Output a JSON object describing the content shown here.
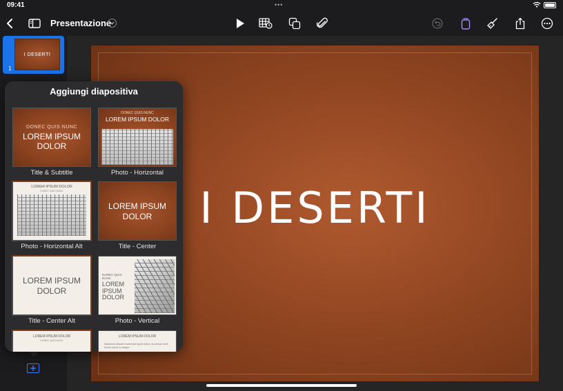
{
  "status_bar": {
    "time": "09:41"
  },
  "toolbar": {
    "document_title": "Presentazione"
  },
  "navigator": {
    "slides": [
      {
        "number": "1",
        "title": "I DESERTI"
      }
    ]
  },
  "slide": {
    "title": "I DESERTI"
  },
  "add_slide_popover": {
    "title": "Aggiungi diapositiva",
    "layouts": [
      {
        "label": "Title & Subtitle",
        "kicker": "DONEC QUIS NUNC",
        "heading": "LOREM IPSUM DOLOR"
      },
      {
        "label": "Photo - Horizontal",
        "kicker": "DONEC QUIS NUNC",
        "heading": "LOREM IPSUM DOLOR"
      },
      {
        "label": "Photo - Horizontal Alt",
        "heading": "LOREM IPSUM DOLOR",
        "kicker": "DONEC QUIS NUNC"
      },
      {
        "label": "Title - Center",
        "heading": "LOREM IPSUM DOLOR"
      },
      {
        "label": "Title - Center Alt",
        "heading": "LOREM IPSUM DOLOR"
      },
      {
        "label": "Photo - Vertical",
        "kicker": "DONEC QUIS NUNC",
        "heading": "LOREM IPSUM DOLOR"
      },
      {
        "heading": "LOREM IPSUM DOLOR",
        "kicker": "DONEC QUIS NUNC"
      },
      {
        "heading": "LOREM IPSUM DOLOR",
        "body": "Maecenas aliquam maecenas ligula nostra, accumsan taciti. Sociis mauris in integer."
      }
    ]
  },
  "colors": {
    "accent": "#1a73e8",
    "add_button": "#3a7bff",
    "slide_brown": "#934722",
    "popover_bg": "#2c2c2e",
    "toolbar_bg": "#1c1c1e"
  },
  "icons": [
    "back-chevron-icon",
    "sidebar-icon",
    "chevron-down-icon",
    "play-icon",
    "table-icon",
    "shapes-icon",
    "paperclip-icon",
    "undo-icon",
    "format-brush-icon",
    "share-icon",
    "more-icon",
    "add-slide-icon"
  ]
}
